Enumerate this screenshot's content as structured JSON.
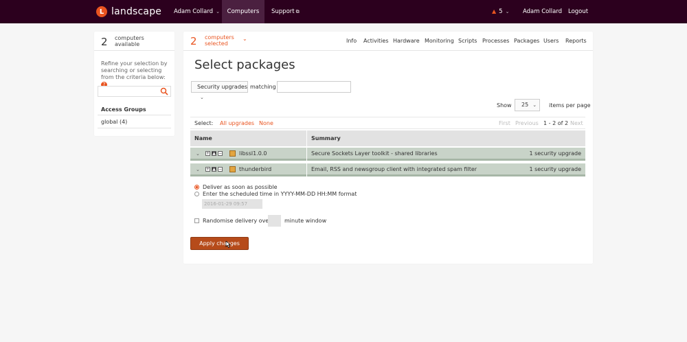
{
  "app": {
    "brand": "landscape",
    "logo_letter": "L",
    "accent_color": "#e95420",
    "topbar_color": "#2c001e"
  },
  "topnav": {
    "account": "Adam Collard",
    "computers": "Computers",
    "support": "Support",
    "alerts_count": "5",
    "user": "Adam Collard",
    "logout": "Logout"
  },
  "sidebar": {
    "available_count": "2",
    "available_label_1": "computers",
    "available_label_2": "available",
    "refine_text": "Refine your selection by searching or selecting from the criteria below:",
    "help": "?",
    "access_groups_title": "Access Groups",
    "access_groups": [
      {
        "label": "global (4)"
      }
    ]
  },
  "selection": {
    "count": "2",
    "label_1": "computers",
    "label_2": "selected"
  },
  "tabs": [
    "Info",
    "Activities",
    "Hardware",
    "Monitoring",
    "Scripts",
    "Processes",
    "Packages",
    "Users",
    "Reports"
  ],
  "page": {
    "title": "Select packages"
  },
  "filter": {
    "type_value": "Security upgrades",
    "matching_label": "matching",
    "search_value": ""
  },
  "paging": {
    "show_label": "Show",
    "page_size": "25",
    "per_page_label": "items per page",
    "first": "First",
    "previous": "Previous",
    "range": "1 - 2 of 2",
    "next": "Next"
  },
  "select_bar": {
    "label": "Select:",
    "all_upgrades": "All upgrades",
    "none": "None"
  },
  "table": {
    "columns": [
      "Name",
      "Summary"
    ],
    "rows": [
      {
        "name": "libssl1.0.0",
        "summary": "Secure Sockets Layer toolkit - shared libraries",
        "status": "1 security upgrade"
      },
      {
        "name": "thunderbird",
        "summary": "Email, RSS and newsgroup client with integrated spam filter",
        "status": "1 security upgrade"
      }
    ]
  },
  "delivery": {
    "asap": "Deliver as soon as possible",
    "scheduled": "Enter the scheduled time in YYYY-MM-DD HH:MM format",
    "scheduled_value": "2016-01-29 09:57",
    "randomise_prefix": "Randomise delivery over a",
    "randomise_suffix": "minute window",
    "minutes_value": ""
  },
  "actions": {
    "apply": "Apply changes"
  }
}
